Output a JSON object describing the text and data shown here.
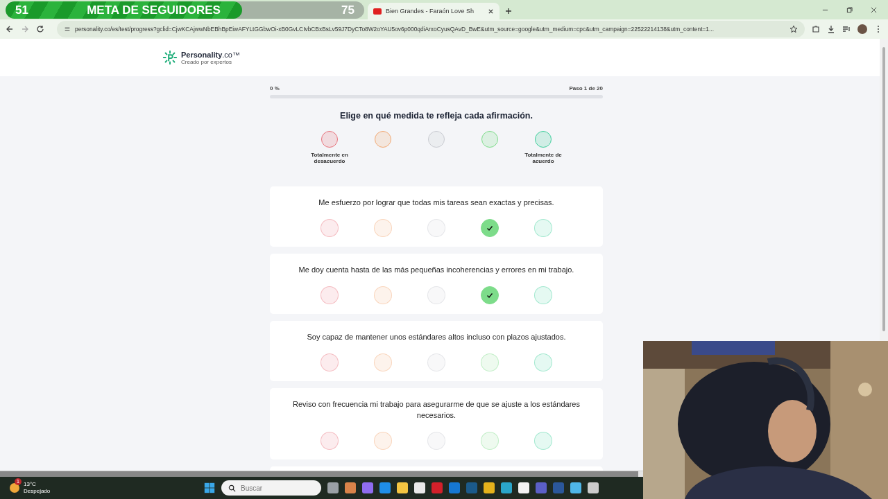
{
  "goal_overlay": {
    "start": "51",
    "title": "META DE SEGUIDORES",
    "target": "75",
    "level": 0.66
  },
  "browser": {
    "tab": {
      "title": "Bien Grandes - Faraón Love Sh"
    },
    "address": "personality.co/es/test/progress?gclid=CjwKCAjwwNbEBhBpEiwAFYLtGGbwOi-xB0GvLCIvbCBxBsLv59J7DyCTo8W2oYAU5ov6p000qdiArxoCyusQAvD_BwE&utm_source=google&utm_medium=cpc&utm_campaign=22522214138&utm_content=1..."
  },
  "header": {
    "brand": "Personality",
    "brand_suffix": ".co™",
    "tagline": "Creado por expertos"
  },
  "progress": {
    "percent": "0 %",
    "step": "Paso 1 de 20",
    "level": 0
  },
  "instruction": "Elige en qué medida te refleja cada afirmación.",
  "scale": [
    {
      "label": "Totalmente en desacuerdo",
      "color": "#e8737c"
    },
    {
      "color": "#f2a872"
    },
    {
      "color": "#c9cbd1"
    },
    {
      "color": "#7ddc8a"
    },
    {
      "label": "Totalmente de acuerdo",
      "color": "#3fcf9c"
    }
  ],
  "questions": [
    {
      "text": "Me esfuerzo por lograr que todas mis tareas sean exactas y precisas.",
      "options": [
        {
          "selected": false
        },
        {
          "selected": false
        },
        {
          "selected": false
        },
        {
          "selected": true
        },
        {
          "selected": false
        }
      ]
    },
    {
      "text": "Me doy cuenta hasta de las más pequeñas incoherencias y errores en mi trabajo.",
      "options": [
        {
          "selected": false
        },
        {
          "selected": false
        },
        {
          "selected": false
        },
        {
          "selected": true
        },
        {
          "selected": false
        }
      ]
    },
    {
      "text": "Soy capaz de mantener unos estándares altos incluso con plazos ajustados.",
      "options": [
        {
          "selected": false
        },
        {
          "selected": false
        },
        {
          "selected": false
        },
        {
          "selected": false
        },
        {
          "selected": false
        }
      ]
    },
    {
      "text": "Reviso con frecuencia mi trabajo para asegurarme de que se ajuste a los estándares necesarios.",
      "options": [
        {
          "selected": false
        },
        {
          "selected": false
        },
        {
          "selected": false
        },
        {
          "selected": false
        },
        {
          "selected": false
        }
      ]
    }
  ],
  "taskbar": {
    "weather": {
      "temp": "13°C",
      "condition": "Despejado",
      "badge": "1"
    },
    "search": {
      "placeholder": "Buscar"
    }
  }
}
